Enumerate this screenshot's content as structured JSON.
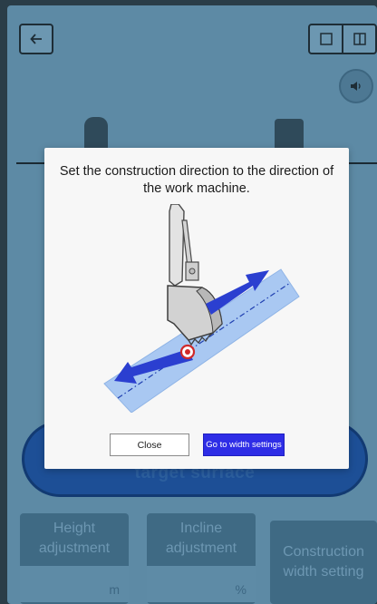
{
  "background": {
    "target_surface_label": "target surface",
    "tiles": [
      {
        "label": "Height adjustment",
        "unit": "m"
      },
      {
        "label": "Incline adjustment",
        "unit": "%"
      },
      {
        "label": "Construction width setting"
      }
    ]
  },
  "dialog": {
    "message": "Set the construction direction to the direction of the work machine.",
    "close_label": "Close",
    "width_settings_label": "Go to width settings"
  },
  "colors": {
    "overlay_bg": "#5d8aa5",
    "primary_button": "#2e2de6",
    "arrow_blue": "#2b3fd0",
    "surface_strip": "#a9c8f2"
  }
}
